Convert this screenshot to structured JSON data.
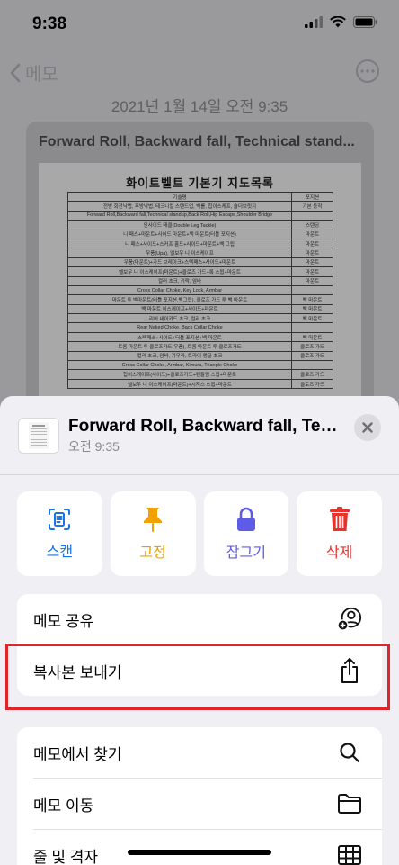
{
  "status_bar": {
    "time": "9:38"
  },
  "nav": {
    "back_label": "메모"
  },
  "note": {
    "date": "2021년 1월 14일 오전 9:35",
    "card_title": "Forward Roll, Backward fall, Technical stand...",
    "document": {
      "title": "화이트벨트 기본기 지도목록",
      "header": [
        "기술명",
        "포지션"
      ],
      "rows": [
        [
          "전방 회전낙법, 후방낙법, 테크니컬 스탠드업, 백롤, 힙이스케프, 숄더브릿지",
          "기본 동작"
        ],
        [
          "Forward Roll,Backward fall,Technical standup,Back Roll,Hip Escape,Shoulder Bridge",
          ""
        ],
        [
          "인사이드 태클(Double Leg Tackle)",
          "스탠딩"
        ],
        [
          "니 패스+마운트+사이드 마운트+백 마운트(터틀 포지션)",
          "마운트"
        ],
        [
          "니 패스+사이드+스커프 홀드+사이드+마운트+백 그립",
          "마운트"
        ],
        [
          "우풍(Upa), 엘보우 니 이스케이프",
          "마운트"
        ],
        [
          "우풍(마운트)+가드 브레이크+스텍패스+사이드+마운트",
          "마운트"
        ],
        [
          "엘보우 니 이스케이프(마운트)+클로즈 가드+록 스윕+마운트",
          "마운트"
        ],
        [
          "컬러 초크, 키락, 암바",
          "마운트"
        ],
        [
          "Cross Collar Choke, Key Lock, Armbar",
          ""
        ],
        [
          "마운트 투 백마운트(터틀 포지션,백그립), 클로즈 가드 투 백 마운트",
          "백 마운트"
        ],
        [
          "백 마운트 이스케이프+사이드+마운트",
          "백 마운트"
        ],
        [
          "리어 네이키드 초크, 컬러 초크",
          "백 마운트"
        ],
        [
          "Rear Naked Choke, Back Collar Choke",
          ""
        ],
        [
          "스텍패스+사이드+터틀 포지션+백 마운트",
          "백 마운트"
        ],
        [
          "트롬 마운트 투 클로즈가드(우풍), 트롬 마운트 투 클로즈가드",
          "클로즈 가드"
        ],
        [
          "컬러 초크, 암바, 기무라, 트라이 앵글 초크",
          "클로즈 가드"
        ],
        [
          "Cross Collar Choke, Armbar, Kimura, Triangle Choke",
          ""
        ],
        [
          "힙이스케이프(사이드)+클로즈가드+펜듈럼 스윕+마운트",
          "클로즈 가드"
        ],
        [
          "엘보우 니 이스케이프(마운트)+시저스 스윕+마운트",
          "클로즈 가드"
        ]
      ]
    }
  },
  "sheet": {
    "title": "Forward Roll, Backward fall, Tech...",
    "subtitle": "오전 9:35",
    "actions": [
      {
        "label": "스캔",
        "icon": "scan-icon",
        "color": "#1a73e8"
      },
      {
        "label": "고정",
        "icon": "pin-icon",
        "color": "#f2a100"
      },
      {
        "label": "잠그기",
        "icon": "lock-icon",
        "color": "#5e5ce6"
      },
      {
        "label": "삭제",
        "icon": "trash-icon",
        "color": "#e5322d"
      }
    ],
    "list1": [
      {
        "label": "메모 공유",
        "icon": "share-person-icon"
      },
      {
        "label": "복사본 보내기",
        "icon": "share-icon"
      }
    ],
    "list2": [
      {
        "label": "메모에서 찾기",
        "icon": "search-icon"
      },
      {
        "label": "메모 이동",
        "icon": "folder-icon"
      },
      {
        "label": "줄 및 격자",
        "icon": "grid-icon"
      }
    ]
  },
  "highlight_color": "#e0242b"
}
